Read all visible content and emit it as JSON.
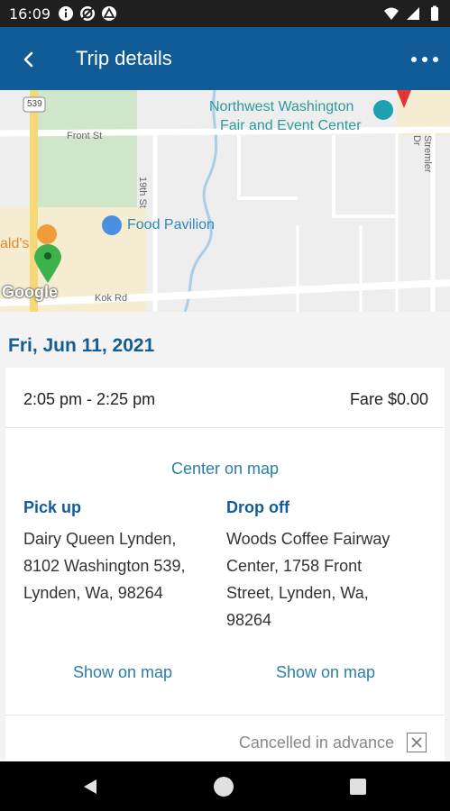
{
  "status_bar": {
    "time": "16:09",
    "icons_left": [
      "info-icon",
      "no-sync-icon",
      "triangle-app-icon"
    ],
    "icons_right": [
      "wifi-icon",
      "signal-icon",
      "battery-icon"
    ]
  },
  "app_bar": {
    "title": "Trip details",
    "back_icon": "chevron-left-icon",
    "more_icon": "more-horizontal-icon",
    "color": "#115b97"
  },
  "map": {
    "labels": {
      "fair_line1": "Northwest Washington",
      "fair_line2": "Fair and Event Center",
      "food_pavilion": "Food Pavilion",
      "mcdonalds_partial": "ald's",
      "front_st": "Front St",
      "kok_rd": "Kok Rd",
      "nineteenth_st": "19th St",
      "stremler_dr": "Stremler Dr",
      "route": "539",
      "google": "Google"
    },
    "pin_color": "#3bb34a"
  },
  "trip": {
    "date": "Fri, Jun 11, 2021",
    "time_range": "2:05 pm - 2:25 pm",
    "fare": "Fare $0.00",
    "center_on_map": "Center on map",
    "pickup": {
      "title": "Pick up",
      "address": [
        "Dairy Queen Lynden,",
        "8102 Washington 539,",
        "Lynden, Wa, 98264"
      ],
      "show_on_map": "Show on map"
    },
    "dropoff": {
      "title": "Drop off",
      "address": [
        "Woods Coffee Fairway",
        "Center, 1758 Front",
        "Street, Lynden, Wa,",
        "98264"
      ],
      "show_on_map": "Show on map"
    },
    "status": "Cancelled in advance"
  },
  "nav_bar": {
    "icons": [
      "back-triangle-icon",
      "home-circle-icon",
      "recents-square-icon"
    ]
  }
}
